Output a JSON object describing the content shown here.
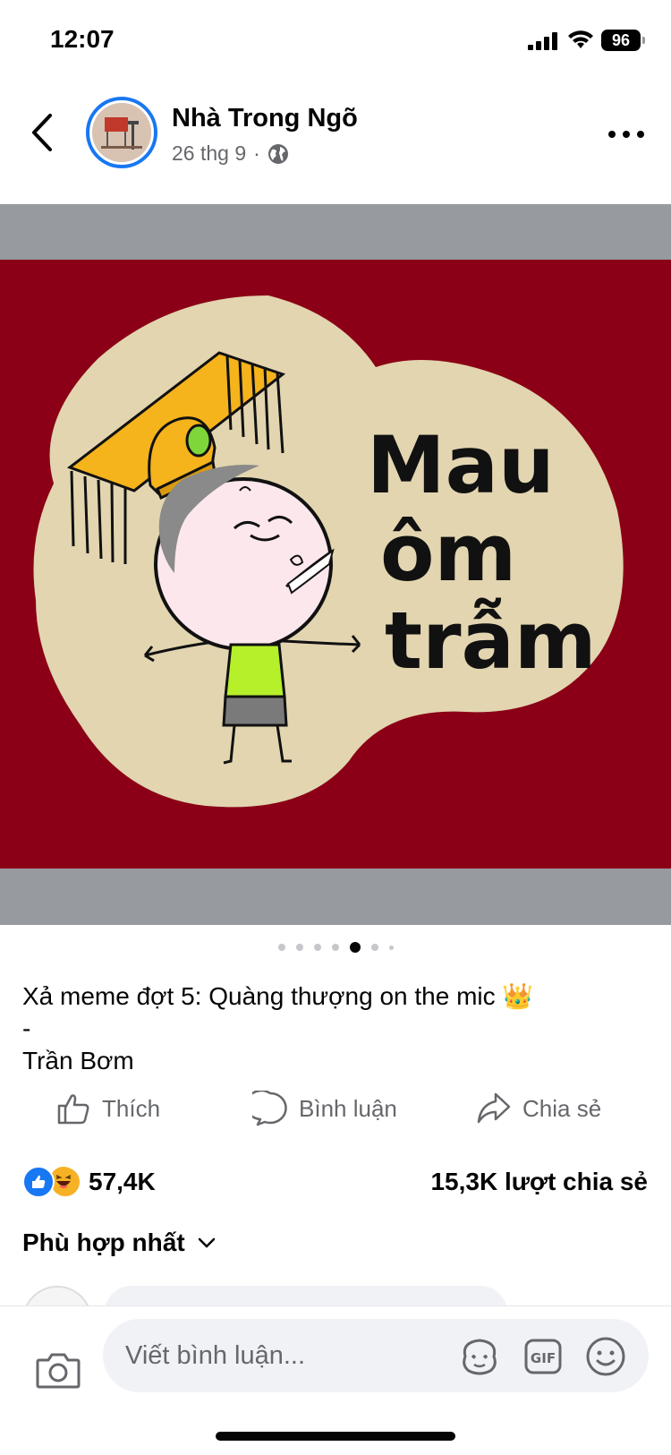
{
  "status_bar": {
    "time": "12:07",
    "battery": "96"
  },
  "header": {
    "page_name": "Nhà Trong Ngõ",
    "date": "26 thg 9",
    "separator": "·",
    "avatar_sign_text": "BƯỚM HÀ"
  },
  "post": {
    "meme_text": [
      "Mau",
      "ôm",
      "trẫm"
    ],
    "carousel": {
      "total": 7,
      "active_index": 4
    },
    "caption": "Xả meme đợt 5: Quàng thượng on the mic 👑\n-\nTrần Bơm"
  },
  "actions": {
    "like": "Thích",
    "comment": "Bình luận",
    "share": "Chia sẻ"
  },
  "stats": {
    "reactions_count": "57,4K",
    "shares": "15,3K lượt chia sẻ"
  },
  "comments": {
    "sort_label": "Phù hợp nhất"
  },
  "composer": {
    "placeholder": "Viết bình luận..."
  },
  "colors": {
    "accent": "#1877f2",
    "meme_background": "#8b0016",
    "meme_blob": "#e2d5b0",
    "crown": "#f5b31c"
  }
}
